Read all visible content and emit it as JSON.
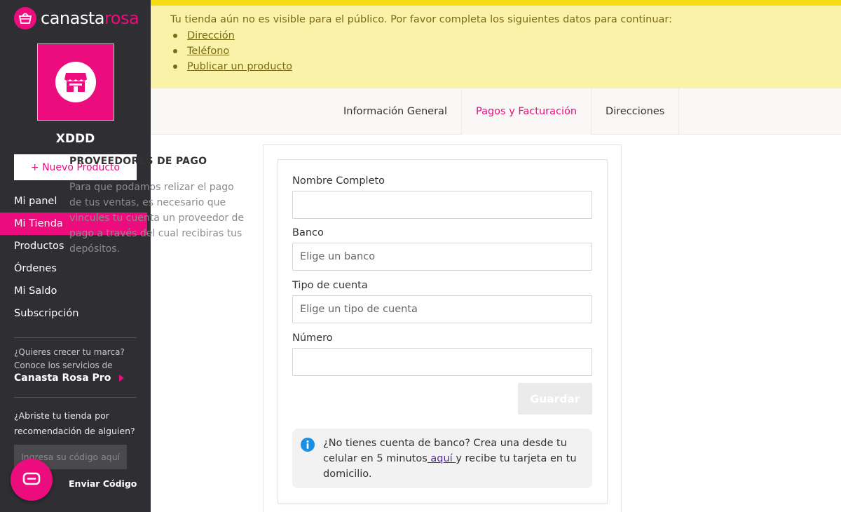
{
  "brand": {
    "name_part1": "canasta",
    "name_part2": "rosa",
    "accent": "#ec0c7e",
    "sidebar_bg": "#2f2f33",
    "banner_bg": "#fbf2a9",
    "banner_border": "#f5dc12"
  },
  "sidebar": {
    "store_name": "XDDD",
    "new_product_label": "+ Nuevo Producto",
    "items": [
      {
        "label": "Mi panel"
      },
      {
        "label": "Mi Tienda"
      },
      {
        "label": "Productos"
      },
      {
        "label": "Órdenes"
      },
      {
        "label": "Mi Saldo"
      },
      {
        "label": "Subscripción"
      }
    ],
    "active_item": "Mi Tienda",
    "promo_text_1": "¿Quieres crecer tu marca?",
    "promo_text_2": "Conoce los servicios de",
    "promo_link": "Canasta Rosa Pro",
    "referral_text": "¿Abriste tu tienda por recomendación de alguien?",
    "code_placeholder": "Ingresa su código aquí",
    "send_code_label": "Enviar Código"
  },
  "banner": {
    "message": "Tu tienda aún no es visible para el público. Por favor completa los siguientes datos para continuar:",
    "links": [
      {
        "label": "Dirección"
      },
      {
        "label": "Teléfono"
      },
      {
        "label": "Publicar un producto"
      }
    ]
  },
  "tabs": [
    {
      "label": "Información General"
    },
    {
      "label": "Pagos y Facturación"
    },
    {
      "label": "Direcciones"
    }
  ],
  "active_tab": "Pagos y Facturación",
  "section": {
    "title": "PROVEEDORES DE PAGO",
    "description": "Para que podamos relizar el pago de tus ventas, es necesario que vincules tu cuenta un proveedor de pago a través del cual recibiras tus depósitos."
  },
  "form": {
    "full_name_label": "Nombre Completo",
    "full_name_value": "",
    "bank_label": "Banco",
    "bank_placeholder": "Elige un banco",
    "account_type_label": "Tipo de cuenta",
    "account_type_placeholder": "Elige un tipo de cuenta",
    "number_label": "Número",
    "number_value": "",
    "save_label": "Guardar"
  },
  "info": {
    "text_before": "¿No tienes cuenta de banco? Crea una desde tu celular en 5 minutos",
    "link": " aquí ",
    "text_after": "y recibe tu tarjeta en tu domicilio."
  }
}
